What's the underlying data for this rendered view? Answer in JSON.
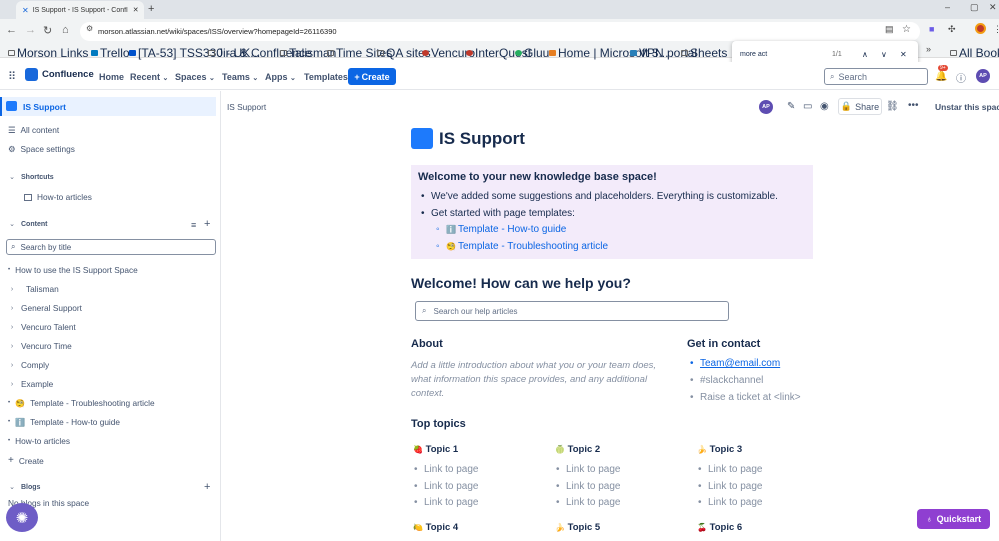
{
  "browser": {
    "tab_title": "IS Support - IS Support - Confl",
    "url": "morson.atlassian.net/wiki/spaces/ISS/overview?homepageId=26116390",
    "bookmarks": [
      "Morson Links",
      "Trello",
      "[TA-53] TSS330 - UK...",
      "Jira & Confluence",
      "Talisman",
      "Time Sites",
      "QA sites",
      "Vencuro",
      "InterQuest",
      "Gluu",
      "Home | Microsoft 3...",
      "VPN portal",
      "Sheets"
    ],
    "bookmarks_overflow": "»",
    "all_bookmarks": "All Bookmarks",
    "find": {
      "query": "more act",
      "count": "1/1"
    }
  },
  "topnav": {
    "logo": "Confluence",
    "items": [
      "Home",
      "Recent",
      "Spaces",
      "Teams",
      "Apps",
      "Templates"
    ],
    "create": "Create",
    "search_placeholder": "Search",
    "notifications_badge": "9+",
    "avatar": "AP"
  },
  "sidebar": {
    "space_name": "IS Support",
    "links": [
      "All content",
      "Space settings"
    ],
    "shortcuts_heading": "Shortcuts",
    "shortcuts": [
      "How-to articles"
    ],
    "content_heading": "Content",
    "search_placeholder": "Search by title",
    "tree": [
      {
        "label": "How to use the IS Support Space",
        "icon": ""
      },
      {
        "label": "Talisman",
        "icon": ""
      },
      {
        "label": "General Support",
        "icon": ""
      },
      {
        "label": "Vencuro Talent",
        "icon": ""
      },
      {
        "label": "Vencuro Time",
        "icon": ""
      },
      {
        "label": "Comply",
        "icon": ""
      },
      {
        "label": "Example",
        "icon": ""
      },
      {
        "label": "Template - Troubleshooting article",
        "icon": "🧐"
      },
      {
        "label": "Template - How-to guide",
        "icon": "ℹ️"
      },
      {
        "label": "How-to articles",
        "icon": ""
      }
    ],
    "create": "Create",
    "blogs_heading": "Blogs",
    "blogs_empty": "No blogs in this space"
  },
  "page": {
    "breadcrumb": "IS Support",
    "share": "Share",
    "unstar": "Unstar this space",
    "avatar": "AP",
    "title": "IS Support",
    "panel_heading": "Welcome to your new knowledge base space!",
    "panel_bullets": [
      "We've added some suggestions and placeholders. Everything is customizable.",
      "Get started with page templates:"
    ],
    "panel_links": [
      "Template - How-to guide",
      "Template - Troubleshooting article"
    ],
    "panel_link_icons": [
      "ℹ️",
      "🧐"
    ],
    "help_heading": "Welcome! How can we help you?",
    "help_search_placeholder": "Search our help articles",
    "about_heading": "About",
    "about_lines": [
      "Add a little introduction about what you or your team does,",
      "what information this space provides, and any additional",
      "context."
    ],
    "contact_heading": "Get in contact",
    "contact_items": [
      "Team@email.com",
      "#slackchannel",
      "Raise a ticket at <link>"
    ],
    "top_topics_heading": "Top topics",
    "topics": [
      {
        "name": "Topic 1",
        "icon": "🍓",
        "links": [
          "Link to page",
          "Link to page",
          "Link to page"
        ]
      },
      {
        "name": "Topic 2",
        "icon": "🍈",
        "links": [
          "Link to page",
          "Link to page",
          "Link to page"
        ]
      },
      {
        "name": "Topic 3",
        "icon": "🍌",
        "links": [
          "Link to page",
          "Link to page",
          "Link to page"
        ]
      },
      {
        "name": "Topic 4",
        "icon": "🍋"
      },
      {
        "name": "Topic 5",
        "icon": "🍌"
      },
      {
        "name": "Topic 6",
        "icon": "🍒"
      }
    ],
    "quickstart": "Quickstart"
  }
}
